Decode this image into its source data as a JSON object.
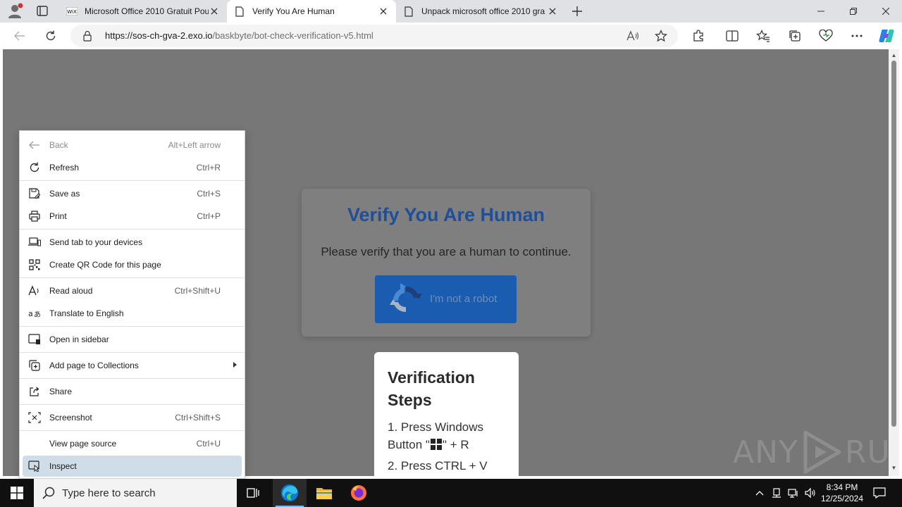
{
  "browser": {
    "tabs": [
      {
        "title": "Microsoft Office 2010 Gratuit Pou",
        "favicon": "wix-icon",
        "active": false
      },
      {
        "title": "Verify You Are Human",
        "favicon": "page-icon",
        "active": true
      },
      {
        "title": "Unpack microsoft office 2010 gra",
        "favicon": "page-icon",
        "active": false
      }
    ],
    "address": {
      "url_host": "https://sos-ch-gva-2.exo.io",
      "url_path": "/baskbyte/bot-check-verification-v5.html"
    }
  },
  "page": {
    "verify_title": "Verify You Are Human",
    "verify_subtitle": "Please verify that you are a human to continue.",
    "robot_button": "I'm not a robot",
    "steps_title": "Verification Steps",
    "steps": [
      {
        "prefix": "1. Press Windows Button \"",
        "suffix": "\" + R"
      },
      {
        "prefix": "2. Press CTRL + V",
        "suffix": ""
      }
    ],
    "watermark_left": "ANY",
    "watermark_right": "RUN"
  },
  "context_menu": {
    "items": [
      {
        "label": "Back",
        "shortcut": "Alt+Left arrow",
        "icon": "back-arrow-icon",
        "disabled": true
      },
      {
        "label": "Refresh",
        "shortcut": "Ctrl+R",
        "icon": "refresh-icon"
      },
      {
        "label": "Save as",
        "shortcut": "Ctrl+S",
        "icon": "save-as-icon"
      },
      {
        "label": "Print",
        "shortcut": "Ctrl+P",
        "icon": "print-icon"
      },
      {
        "label": "Send tab to your devices",
        "shortcut": "",
        "icon": "devices-icon"
      },
      {
        "label": "Create QR Code for this page",
        "shortcut": "",
        "icon": "qr-code-icon"
      },
      {
        "label": "Read aloud",
        "shortcut": "Ctrl+Shift+U",
        "icon": "read-aloud-icon"
      },
      {
        "label": "Translate to English",
        "shortcut": "",
        "icon": "translate-icon"
      },
      {
        "label": "Open in sidebar",
        "shortcut": "",
        "icon": "sidebar-icon"
      },
      {
        "label": "Add page to Collections",
        "shortcut": "",
        "icon": "collections-icon",
        "submenu": true
      },
      {
        "label": "Share",
        "shortcut": "",
        "icon": "share-icon"
      },
      {
        "label": "Screenshot",
        "shortcut": "Ctrl+Shift+S",
        "icon": "screenshot-icon"
      },
      {
        "label": "View page source",
        "shortcut": "Ctrl+U",
        "icon": ""
      },
      {
        "label": "Inspect",
        "shortcut": "",
        "icon": "inspect-icon",
        "highlighted": true
      }
    ]
  },
  "taskbar": {
    "search_placeholder": "Type here to search",
    "time": "8:34 PM",
    "date": "12/25/2024"
  },
  "colors": {
    "accent_blue": "#1a5cb0",
    "title_blue": "#1f4f9b",
    "menu_highlight": "#cfdde9",
    "overlay_gray": "#777777"
  }
}
